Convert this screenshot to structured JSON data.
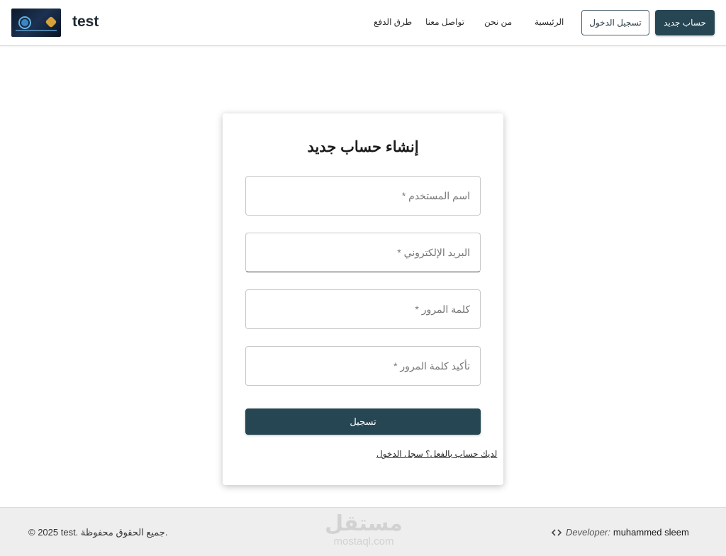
{
  "header": {
    "brand": "test",
    "nav": {
      "payment": "طرق الدفع",
      "contact": "تواصل معنا",
      "about": "من نحن",
      "home": "الرئيسية"
    },
    "login_button": "تسجيل الدخول",
    "register_button": "حساب جديد",
    "accent_color": "#264653"
  },
  "form": {
    "title": "إنشاء حساب جديد",
    "fields": [
      {
        "placeholder": "اسم المستخدم *"
      },
      {
        "placeholder": "البريد الإلكتروني *"
      },
      {
        "placeholder": "كلمة المرور *"
      },
      {
        "placeholder": "تأكيد كلمة المرور *"
      }
    ],
    "submit_label": "تسجيل",
    "login_link": "لديك حساب بالفعل؟ سجل الدخول"
  },
  "footer": {
    "copyright": "© 2025 test. جميع الحقوق محفوظة.",
    "watermark_ar": "مستقل",
    "watermark_en": "mostaql.com",
    "developer_label": "Developer:",
    "developer_name": "muhammed sleem"
  },
  "icons": {
    "logo": "site-logo",
    "developer": "code-icon"
  }
}
